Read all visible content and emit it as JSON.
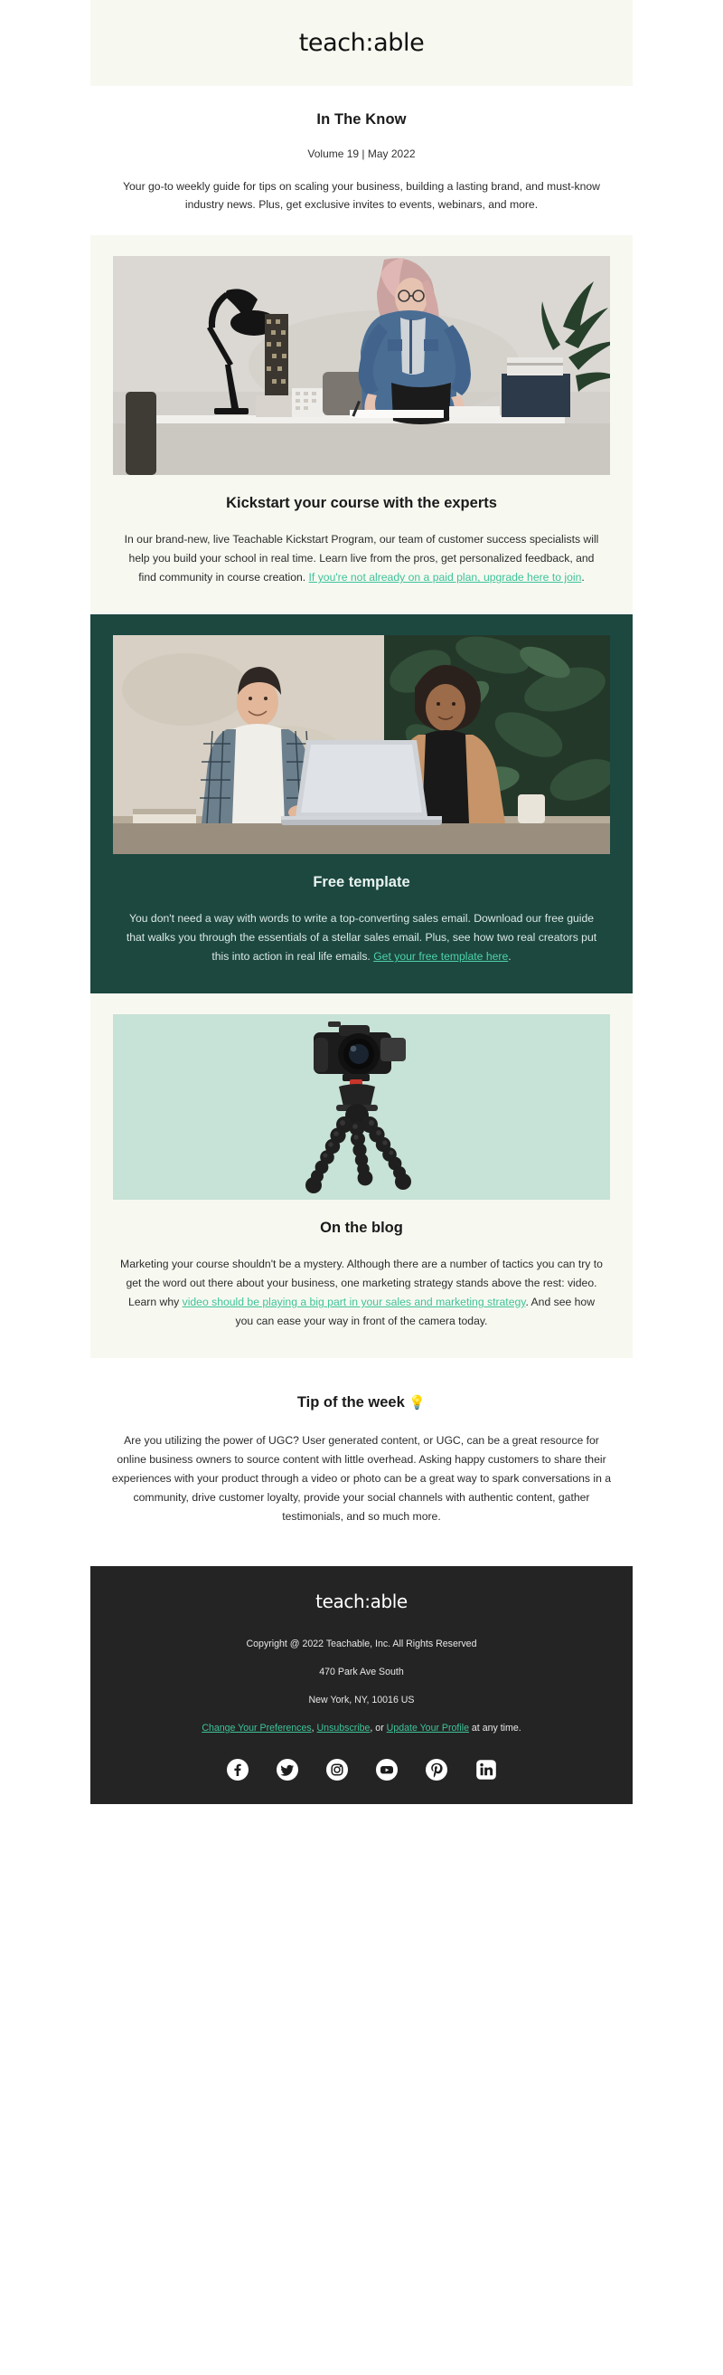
{
  "brand": {
    "logo_text": "teach:able"
  },
  "header": {
    "title": "In The Know",
    "volume": "Volume 19 | May 2022",
    "description": "Your go-to weekly guide for tips on scaling your business, building a lasting brand, and must-know industry news. Plus, get exclusive invites to events, webinars, and more."
  },
  "sections": [
    {
      "id": "kickstart",
      "theme": "cream",
      "image_alt": "woman-standing-at-desk-photo",
      "heading": "Kickstart your course with the experts",
      "body_before": "In our brand-new, live Teachable Kickstart Program, our team of customer success specialists will help you build your school in real time. Learn live from the pros, get personalized feedback, and find community in course creation. ",
      "link_text": "If you're not already on a paid plan, upgrade here to join",
      "body_after": "."
    },
    {
      "id": "free-template",
      "theme": "green",
      "image_alt": "two-people-at-laptop-photo",
      "heading": "Free template",
      "body_before": "You don't need a way with words to write a top-converting sales email. Download our free guide that walks you through the essentials of a stellar sales email. Plus, see how two real creators put this into action in real life emails. ",
      "link_text": "Get your free template here",
      "body_after": "."
    },
    {
      "id": "on-the-blog",
      "theme": "cream",
      "image_alt": "camera-on-tripod-illustration",
      "heading": "On the blog",
      "body_before": "Marketing your course shouldn't be a mystery. Although there are a number of tactics you can try to get the word out there about your business, one marketing strategy stands above the rest: video. Learn why ",
      "link_text": "video should be playing a big part in your sales and marketing strategy",
      "body_after": ". And see how you can ease your way in front of the camera today."
    }
  ],
  "tip": {
    "heading": "Tip of the week",
    "bulb_icon": "lightbulb-icon",
    "body": "Are you utilizing the power of UGC? User generated content, or UGC, can be a great resource for online business owners to source content with little overhead. Asking happy customers to share their experiences with your product through a video or photo can be a great way to spark conversations in a community, drive customer loyalty, provide your social channels with authentic content, gather testimonials, and so much more."
  },
  "footer": {
    "logo_text": "teach:able",
    "copyright": "Copyright @ 2022 Teachable, Inc. All Rights Reserved",
    "address_line1": "470 Park Ave South",
    "address_line2": "New York, NY, 10016 US",
    "prefs_link": "Change Your Preferences",
    "sep1": ", ",
    "unsub_link": "Unsubscribe",
    "sep2": ", or ",
    "profile_link": "Update Your Profile",
    "tail": " at any time.",
    "social": [
      {
        "name": "facebook-icon",
        "label": "Facebook"
      },
      {
        "name": "twitter-icon",
        "label": "Twitter"
      },
      {
        "name": "instagram-icon",
        "label": "Instagram"
      },
      {
        "name": "youtube-icon",
        "label": "YouTube"
      },
      {
        "name": "pinterest-icon",
        "label": "Pinterest"
      },
      {
        "name": "linkedin-icon",
        "label": "LinkedIn"
      }
    ]
  },
  "colors": {
    "cream": "#f7f9f1",
    "dark_green": "#1c4840",
    "mint": "#c7e2d6",
    "accent_link": "#3fc39a",
    "footer_bg": "#242424"
  }
}
